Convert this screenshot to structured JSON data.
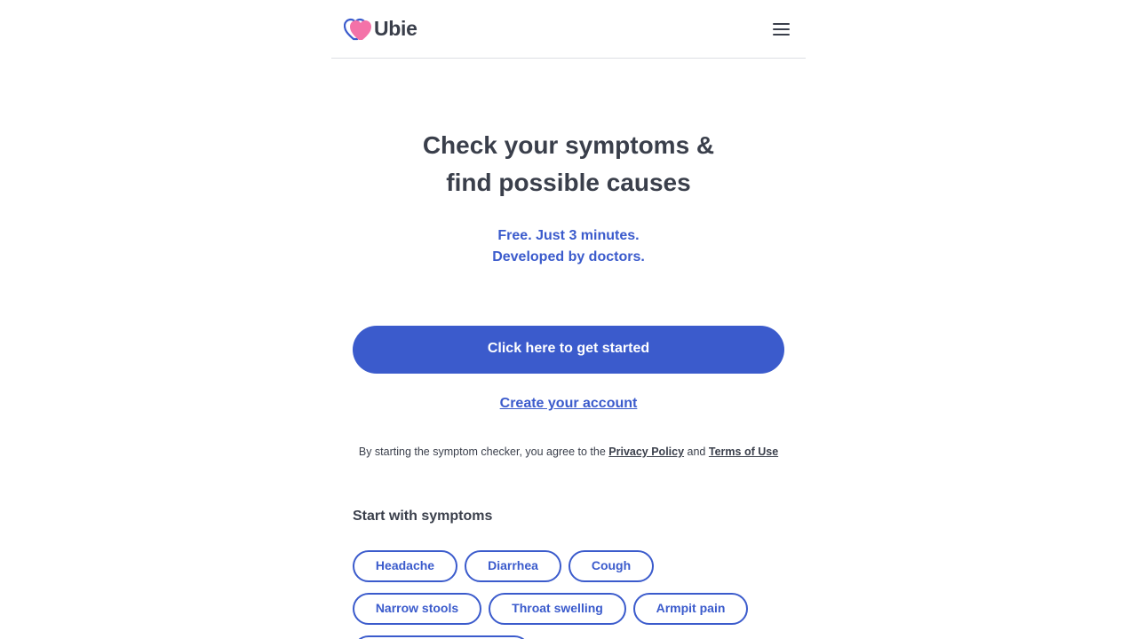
{
  "header": {
    "brand": "Ubie",
    "logo_icon": "heart-logo-icon",
    "menu_icon": "hamburger-menu-icon"
  },
  "hero": {
    "title_line1": "Check your symptoms &",
    "title_line2": "find possible causes",
    "subtitle_line1": "Free. Just 3 minutes.",
    "subtitle_line2": "Developed by doctors."
  },
  "cta": {
    "start_label": "Click here to get started",
    "create_account_label": "Create your account"
  },
  "legal": {
    "prefix": "By starting the symptom checker, you agree to the",
    "privacy_label": "Privacy Policy",
    "and": "and",
    "terms_label": "Terms of Use"
  },
  "symptoms": {
    "title": "Start with symptoms",
    "items": [
      "Headache",
      "Diarrhea",
      "Cough",
      "Narrow stools",
      "Throat swelling",
      "Armpit pain"
    ]
  },
  "colors": {
    "primary": "#3b5bcc",
    "text": "#3a3f4b",
    "logo_pink": "#f472a8",
    "logo_blue": "#3b5bcc"
  }
}
